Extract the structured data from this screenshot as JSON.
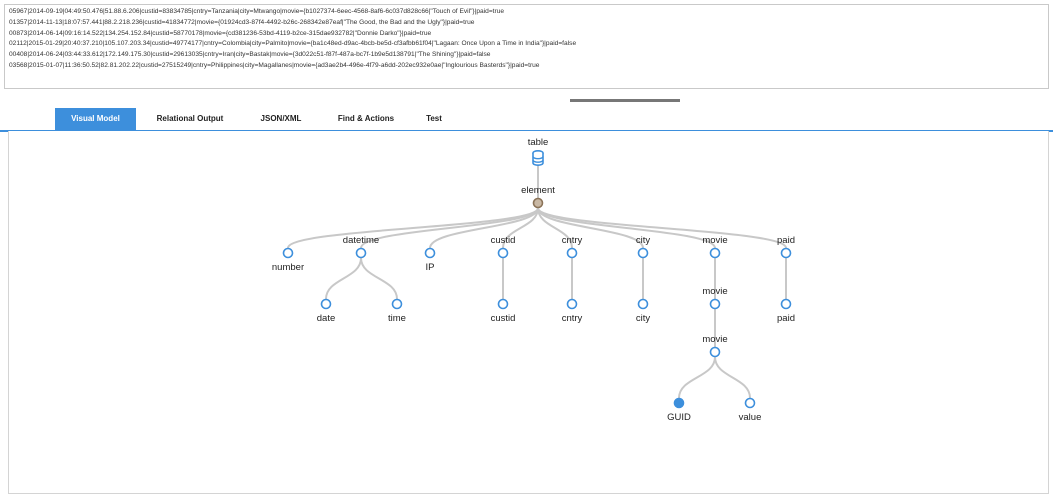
{
  "sample_data": {
    "lines": [
      "05967|2014-09-19|04:49:50.476|51.88.6.206|custid=83834785|cntry=Tanzania|city=Mtwango|movie={b1027374-6eec-4568-8af6-6c037d828c66|\"Touch of Evil\"}|paid=true",
      "01357|2014-11-13|18:07:57.441|88.2.218.236|custid=41834772|movie={01924cd3-87f4-4492-b26c-268342e87eaf|\"The Good, the Bad and the Ugly\"}|paid=true",
      "00873|2014-06-14|09:16:14.522|134.254.152.84|custid=58770178|movie={cd381236-53bd-4119-b2ce-315dae932782|\"Donnie Darko\"}|paid=true",
      "02112|2015-01-29|20:40:37.210|105.107.203.34|custid=49774177|cntry=Colombia|city=Palmito|movie={ba1c48ed-d9ac-4bcb-be5d-cf3afbb61f04|\"Lagaan: Once Upon a Time in India\"}|paid=false",
      "00408|2014-06-24|03:44:33.612|172.149.175.30|custid=29613035|cntry=Iran|city=Bastak|movie={3d022c51-f87f-487a-bc7f-1b9e5d138791|\"The Shining\"}|paid=false",
      "03568|2015-01-07|11:36:50.52|82.81.202.22|custid=27515249|cntry=Philippines|city=Magallanes|movie={ad3ae2b4-496e-4f79-a6dd-202ec932e0ae|\"Inglourious Basterds\"}|paid=true"
    ]
  },
  "tabs": [
    {
      "label": "Visual Model",
      "active": true
    },
    {
      "label": "Relational Output",
      "active": false
    },
    {
      "label": "JSON/XML",
      "active": false
    },
    {
      "label": "Find & Actions",
      "active": false
    },
    {
      "label": "Test",
      "active": false
    }
  ],
  "tree": {
    "colors": {
      "node": "#3d8fdc",
      "element_node": "#8b7358",
      "link": "#c8c8c8"
    },
    "nodes": [
      {
        "id": "table",
        "label": "table",
        "icon": "database-icon"
      },
      {
        "id": "element",
        "label": "element",
        "parent": "table",
        "kind": "element"
      },
      {
        "id": "number",
        "label": "number",
        "parent": "element"
      },
      {
        "id": "datetime",
        "label": "datetime",
        "parent": "element"
      },
      {
        "id": "ip",
        "label": "IP",
        "parent": "element"
      },
      {
        "id": "custid",
        "label": "custid",
        "parent": "element"
      },
      {
        "id": "cntry",
        "label": "cntry",
        "parent": "element"
      },
      {
        "id": "city",
        "label": "city",
        "parent": "element"
      },
      {
        "id": "movie",
        "label": "movie",
        "parent": "element"
      },
      {
        "id": "paid",
        "label": "paid",
        "parent": "element"
      },
      {
        "id": "date",
        "label": "date",
        "parent": "datetime"
      },
      {
        "id": "time",
        "label": "time",
        "parent": "datetime"
      },
      {
        "id": "custid2",
        "label": "custid",
        "parent": "custid"
      },
      {
        "id": "cntry2",
        "label": "cntry",
        "parent": "cntry"
      },
      {
        "id": "city2",
        "label": "city",
        "parent": "city"
      },
      {
        "id": "movie2",
        "label": "movie",
        "parent": "movie"
      },
      {
        "id": "paid2",
        "label": "paid",
        "parent": "paid"
      },
      {
        "id": "movie3",
        "label": "movie",
        "parent": "movie2"
      },
      {
        "id": "guid",
        "label": "GUID",
        "parent": "movie3",
        "filled": true
      },
      {
        "id": "value",
        "label": "value",
        "parent": "movie3"
      }
    ]
  }
}
